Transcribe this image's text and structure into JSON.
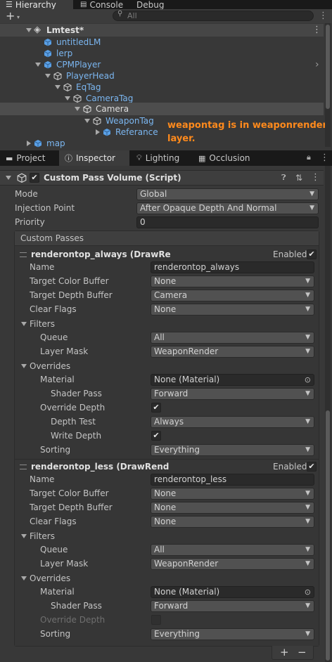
{
  "hierarchy": {
    "tab_label": "Hierarchy",
    "tab2_label": "Console",
    "tab3_label": "Debug",
    "search_placeholder": "All",
    "scene_name": "Lmtest*",
    "items": [
      {
        "label": "untitledLM"
      },
      {
        "label": "lerp"
      },
      {
        "label": "CPMPlayer"
      },
      {
        "label": "PlayerHead"
      },
      {
        "label": "EqTag"
      },
      {
        "label": "CameraTag"
      },
      {
        "label": "Camera"
      },
      {
        "label": "WeaponTag"
      },
      {
        "label": "Referance"
      },
      {
        "label": "map"
      }
    ],
    "annotation": "weapontag is in weaponrender layer."
  },
  "inspector_tabs": [
    "Project",
    "Inspector",
    "Lighting",
    "Occlusion"
  ],
  "component": {
    "title": "Custom Pass Volume (Script)",
    "mode_label": "Mode",
    "mode_value": "Global",
    "injection_label": "Injection Point",
    "injection_value": "After Opaque Depth And Normal",
    "priority_label": "Priority",
    "priority_value": "0",
    "custom_passes_label": "Custom Passes"
  },
  "passes": [
    {
      "title": "renderontop_always (DrawRe",
      "enabled_label": "Enabled",
      "name_label": "Name",
      "name_value": "renderontop_always",
      "tcb_label": "Target Color Buffer",
      "tcb_value": "None",
      "tdb_label": "Target Depth Buffer",
      "tdb_value": "Camera",
      "clear_label": "Clear Flags",
      "clear_value": "None",
      "filters_label": "Filters",
      "queue_label": "Queue",
      "queue_value": "All",
      "layer_label": "Layer Mask",
      "layer_value": "WeaponRender",
      "overrides_label": "Overrides",
      "material_label": "Material",
      "material_value": "None (Material)",
      "shaderpass_label": "Shader Pass",
      "shaderpass_value": "Forward",
      "override_depth_label": "Override Depth",
      "depth_test_label": "Depth Test",
      "depth_test_value": "Always",
      "write_depth_label": "Write Depth",
      "sorting_label": "Sorting",
      "sorting_value": "Everything"
    },
    {
      "title": "renderontop_less (DrawRend",
      "enabled_label": "Enabled",
      "name_label": "Name",
      "name_value": "renderontop_less",
      "tcb_label": "Target Color Buffer",
      "tcb_value": "None",
      "tdb_label": "Target Depth Buffer",
      "tdb_value": "None",
      "clear_label": "Clear Flags",
      "clear_value": "None",
      "filters_label": "Filters",
      "queue_label": "Queue",
      "queue_value": "All",
      "layer_label": "Layer Mask",
      "layer_value": "WeaponRender",
      "overrides_label": "Overrides",
      "material_label": "Material",
      "material_value": "None (Material)",
      "shaderpass_label": "Shader Pass",
      "shaderpass_value": "Forward",
      "override_depth_label": "Override Depth",
      "sorting_label": "Sorting",
      "sorting_value": "Everything"
    }
  ],
  "footer": {
    "add_label": "+",
    "remove_label": "−"
  },
  "colors": {
    "annotation": "#ff8a1c",
    "prefab_blue": "#7bb6f0",
    "selected_row": "#4d4d4d"
  }
}
